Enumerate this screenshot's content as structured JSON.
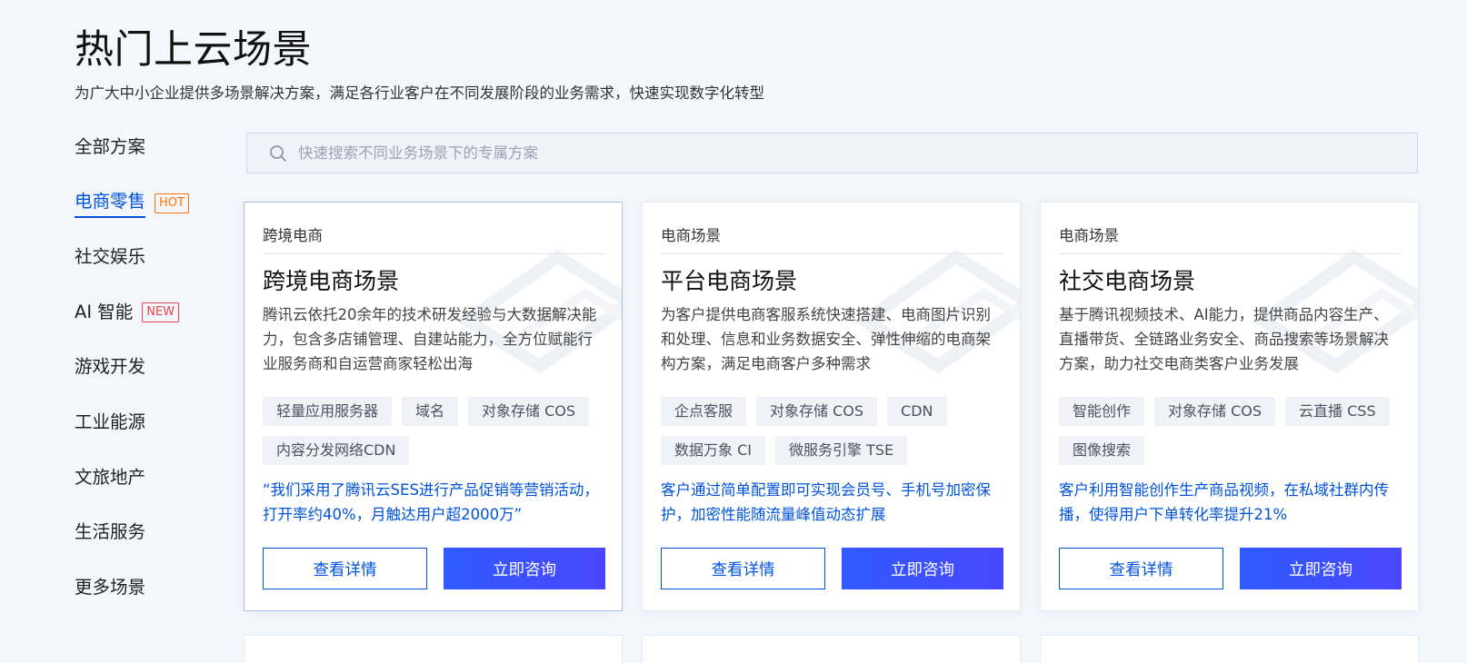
{
  "page": {
    "title": "热门上云场景",
    "subtitle": "为广大中小企业提供多场景解决方案，满足各行业客户在不同发展阶段的业务需求，快速实现数字化转型"
  },
  "sidebar": {
    "items": [
      {
        "label": "全部方案",
        "badge": ""
      },
      {
        "label": "电商零售",
        "badge": "HOT",
        "active": true
      },
      {
        "label": "社交娱乐",
        "badge": ""
      },
      {
        "label": "AI 智能",
        "badge": "NEW"
      },
      {
        "label": "游戏开发",
        "badge": ""
      },
      {
        "label": "工业能源",
        "badge": ""
      },
      {
        "label": "文旅地产",
        "badge": ""
      },
      {
        "label": "生活服务",
        "badge": ""
      },
      {
        "label": "更多场景",
        "badge": ""
      }
    ]
  },
  "search": {
    "placeholder": "快速搜索不同业务场景下的专属方案",
    "value": ""
  },
  "cards": [
    {
      "category": "跨境电商",
      "title": "跨境电商场景",
      "description": "腾讯云依托20余年的技术研发经验与大数据解决能力，包含多店铺管理、自建站能力，全方位赋能行业服务商和自运营商家轻松出海",
      "tags": [
        "轻量应用服务器",
        "域名",
        "对象存储 COS",
        "内容分发网络CDN"
      ],
      "quote": "“我们采用了腾讯云SES进行产品促销等营销活动，打开率约40%，月触达用户超2000万”",
      "detail_label": "查看详情",
      "consult_label": "立即咨询"
    },
    {
      "category": "电商场景",
      "title": "平台电商场景",
      "description": "为客户提供电商客服系统快速搭建、电商图片识别和处理、信息和业务数据安全、弹性伸缩的电商架构方案，满足电商客户多种需求",
      "tags": [
        "企点客服",
        "对象存储 COS",
        "CDN",
        "数据万象 CI",
        "微服务引擎 TSE"
      ],
      "quote": "客户通过简单配置即可实现会员号、手机号加密保护，加密性能随流量峰值动态扩展",
      "detail_label": "查看详情",
      "consult_label": "立即咨询"
    },
    {
      "category": "电商场景",
      "title": "社交电商场景",
      "description": "基于腾讯视频技术、AI能力，提供商品内容生产、直播带货、全链路业务安全、商品搜索等场景解决方案，助力社交电商类客户业务发展",
      "tags": [
        "智能创作",
        "对象存储 COS",
        "云直播 CSS",
        "图像搜索"
      ],
      "quote": "客户利用智能创作生产商品视频，在私域社群内传播，使得用户下单转化率提升21%",
      "detail_label": "查看详情",
      "consult_label": "立即咨询"
    }
  ],
  "colors": {
    "accent": "#0052d9",
    "hot_badge": "#ff7200",
    "new_badge": "#e54545",
    "consult_button": "#3d50ff",
    "background": "#f3f6fc"
  },
  "icons": {
    "search": "search-icon"
  }
}
